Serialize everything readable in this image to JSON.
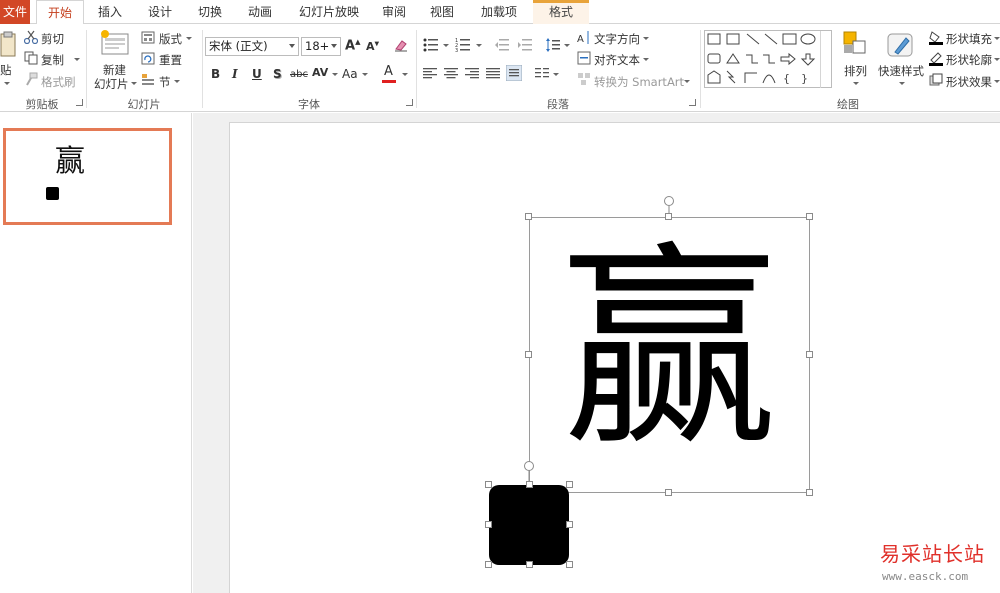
{
  "tabs": {
    "file": "文件",
    "home": "开始",
    "insert": "插入",
    "design": "设计",
    "transitions": "切换",
    "animations": "动画",
    "slideshow": "幻灯片放映",
    "review": "审阅",
    "view": "视图",
    "addins": "加载项",
    "format": "格式"
  },
  "clipboard": {
    "paste": "贴",
    "cut": "剪切",
    "copy": "复制",
    "format_painter": "格式刷",
    "group_label": "剪贴板"
  },
  "slides": {
    "new_slide_line1": "新建",
    "new_slide_line2": "幻灯片",
    "layout": "版式",
    "reset": "重置",
    "section": "节",
    "group_label": "幻灯片"
  },
  "font": {
    "font_name": "宋体 (正文)",
    "font_size": "18+",
    "bold": "B",
    "italic": "I",
    "underline": "U",
    "shadow": "S",
    "strikethrough": "abc",
    "spacing": "AV",
    "change_case": "Aa",
    "font_color": "A",
    "group_label": "字体"
  },
  "paragraph": {
    "text_direction": "文字方向",
    "align_text": "对齐文本",
    "convert_smartart": "转换为 SmartArt",
    "group_label": "段落"
  },
  "drawing": {
    "arrange": "排列",
    "quick_styles": "快速样式",
    "shape_fill": "形状填充",
    "shape_outline": "形状轮廓",
    "shape_effects": "形状效果",
    "group_label": "绘图"
  },
  "thumbnail": {
    "text": "赢"
  },
  "slide": {
    "big_text": "赢"
  },
  "watermark": {
    "text": "易采站长站",
    "url": "www.easck.com"
  },
  "colors": {
    "file_tab": "#d24726",
    "accent": "#c43e1c",
    "thumb_border": "#e47a55",
    "context_tab": "#e8a33a",
    "font_color_bar": "#e02020"
  }
}
